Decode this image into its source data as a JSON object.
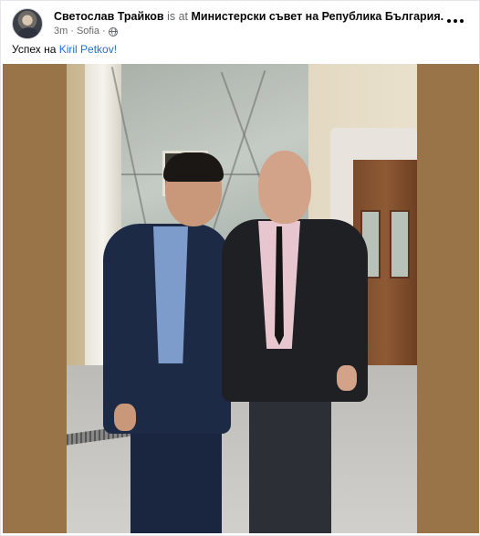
{
  "post": {
    "author": "Светослав Трайков",
    "is_at": "is at",
    "place": "Министерски съвет на Република България.",
    "time": "3m",
    "separator": "·",
    "location": "Sofia",
    "separator2": "·",
    "privacy_icon": "globe-icon",
    "text_prefix": "Успех на ",
    "mention": "Kiril Petkov!",
    "more_icon": "more-horizontal-icon"
  },
  "colors": {
    "link": "#216fdb",
    "secondary_text": "#65676b",
    "photo_border": "#9a7449"
  }
}
